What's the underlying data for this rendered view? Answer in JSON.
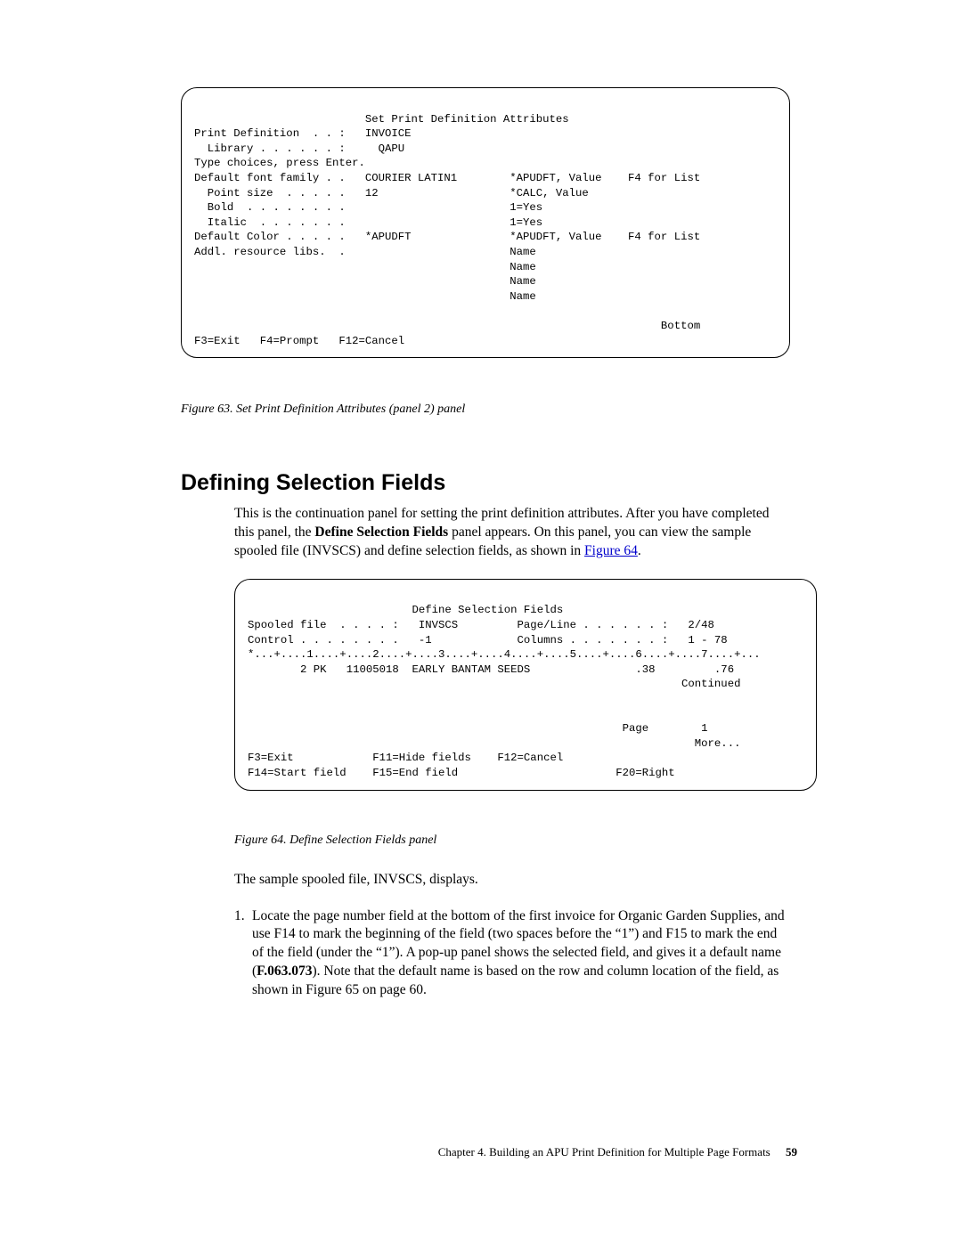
{
  "panel1": {
    "title_line": "                          Set Print Definition Attributes",
    "l1": "Print Definition  . . :   INVOICE",
    "l2": "  Library . . . . . . :     QAPU",
    "l3": "Type choices, press Enter.",
    "l4": "Default font family . .   COURIER LATIN1        *APUDFT, Value    F4 for List",
    "l5": "  Point size  . . . . .   12                    *CALC, Value",
    "l6": "  Bold  . . . . . . . .                         1=Yes",
    "l7": "  Italic  . . . . . . .                         1=Yes",
    "l8": "Default Color . . . . .   *APUDFT               *APUDFT, Value    F4 for List",
    "l9": "Addl. resource libs.  .                         Name",
    "l10": "                                                Name",
    "l11": "                                                Name",
    "l12": "                                                Name",
    "blank": "",
    "bottom": "                                                                       Bottom",
    "keys": "F3=Exit   F4=Prompt   F12=Cancel"
  },
  "fig63_caption": "Figure 63. Set Print Definition Attributes (panel 2) panel",
  "section_heading": "Defining Selection Fields",
  "para1_a": "This is the continuation panel for setting the print definition attributes. After you have completed this panel, the ",
  "para1_bold": "Define Selection Fields",
  "para1_b": " panel appears. On this panel, you can view the sample spooled file (INVSCS) and define selection fields, as shown in ",
  "para1_link": "Figure 64",
  "para1_c": ".",
  "panel2": {
    "title": "                         Define Selection Fields",
    "l1": "Spooled file  . . . . :   INVSCS         Page/Line . . . . . . :   2/48",
    "l2": "Control . . . . . . . .   -1             Columns . . . . . . . :   1 - 78",
    "l3": "*...+....1....+....2....+....3....+....4....+....5....+....6....+....7....+...",
    "l4": "        2 PK   11005018  EARLY BANTAM SEEDS                .38         .76",
    "l5": "                                                                  Continued",
    "blank1": "",
    "blank2": "",
    "l6": "                                                         Page        1",
    "l7": "                                                                    More...",
    "l8": "F3=Exit            F11=Hide fields    F12=Cancel",
    "l9": "F14=Start field    F15=End field                        F20=Right"
  },
  "fig64_caption": "Figure 64. Define Selection Fields panel",
  "para2": "The sample spooled file, INVSCS, displays.",
  "ol1_num": "1.",
  "ol1_a": "Locate the page number field at the bottom of the first invoice for Organic Garden Supplies, and use F14 to mark the beginning of the field (two spaces before the “1”) and F15 to mark the end of the field (under the “1”). A pop-up panel shows the selected field, and gives it a default name (",
  "ol1_bold": "F.063.073",
  "ol1_b": "). Note that the default name is based on the row and column location of the field, as shown in Figure 65 on page 60.",
  "footer_chapter": "Chapter 4. Building an APU Print Definition for Multiple Page Formats",
  "footer_page": "59"
}
